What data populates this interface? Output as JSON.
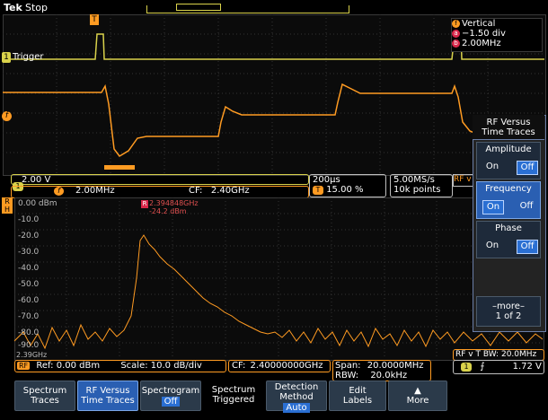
{
  "colors": {
    "ch1": "#d9d24b",
    "rf": "#ff9b22",
    "marker": "#d9274a",
    "button_active": "#2a5fb2"
  },
  "header": {
    "brand": "Tek",
    "status": "Stop"
  },
  "time_panel": {
    "trigger_tag": "1",
    "trigger_label": "Trigger",
    "freq_tag": "f",
    "t_marker": "T"
  },
  "vertical_box": {
    "title": "Vertical",
    "line_a": "−1.50 div",
    "line_b": "2.00MHz",
    "a_icon": "a",
    "b_icon": "b",
    "f_icon": "f"
  },
  "ch1_status": {
    "tag": "1",
    "scale": "2.00 V"
  },
  "freq_status": {
    "tag": "f",
    "value": "2.00MHz",
    "cf_label": "CF:",
    "cf_value": "2.40GHz"
  },
  "time_status": {
    "time_div": "200µs",
    "trig_pos_tag": "T",
    "trig_pos": "15.00 %"
  },
  "rate_status": {
    "rate": "5.00MS/s",
    "points": "10k points"
  },
  "rfv_small": "RF v",
  "spectrum": {
    "side_tag": "R\nH",
    "y_labels": [
      "0.00 dBm",
      "-10.0",
      "-20.0",
      "-30.0",
      "-40.0",
      "-50.0",
      "-60.0",
      "-70.0",
      "-80.0",
      "-90.0"
    ],
    "marker_tag": "R",
    "marker_freq": "2.394848GHz",
    "marker_level": "-24.2 dBm",
    "left_bottom": "2.39GHz"
  },
  "rf_status": {
    "tag": "RF",
    "ref": "Ref: 0.00 dBm",
    "scale": "Scale: 10.0 dB/div"
  },
  "cf_status": {
    "label": "CF:",
    "value": "2.40000000GHz"
  },
  "span_status": {
    "span_label": "Span:",
    "span_value": "20.0000MHz",
    "rbw_label": "RBW:",
    "rbw_value": "20.0kHz"
  },
  "rfvt": {
    "label": "RF v T BW:",
    "value": "20.0MHz"
  },
  "trig_status": {
    "tag": "1",
    "slope": "⨍",
    "level": "1.72 V"
  },
  "side_menu": {
    "title_line1": "RF Versus",
    "title_line2": "Time Traces",
    "amplitude": {
      "label": "Amplitude",
      "on": "On",
      "off": "Off"
    },
    "frequency": {
      "label": "Frequency",
      "on": "On",
      "off": "Off"
    },
    "phase": {
      "label": "Phase",
      "on": "On",
      "off": "Off"
    },
    "more_line1": "–more–",
    "more_line2": "1 of 2"
  },
  "bottom_buttons": [
    {
      "line1": "Spectrum",
      "line2": "Traces"
    },
    {
      "line1": "RF Versus",
      "line2": "Time Traces"
    },
    {
      "line1": "Spectrogram",
      "line2": "Off"
    },
    {
      "line1": "Spectrum",
      "line2": "Triggered"
    },
    {
      "line1": "Detection",
      "line2": "Method",
      "line3": "Auto"
    },
    {
      "line1": "Edit",
      "line2": "Labels"
    },
    {
      "line1": "▲",
      "line2": "More"
    }
  ]
}
